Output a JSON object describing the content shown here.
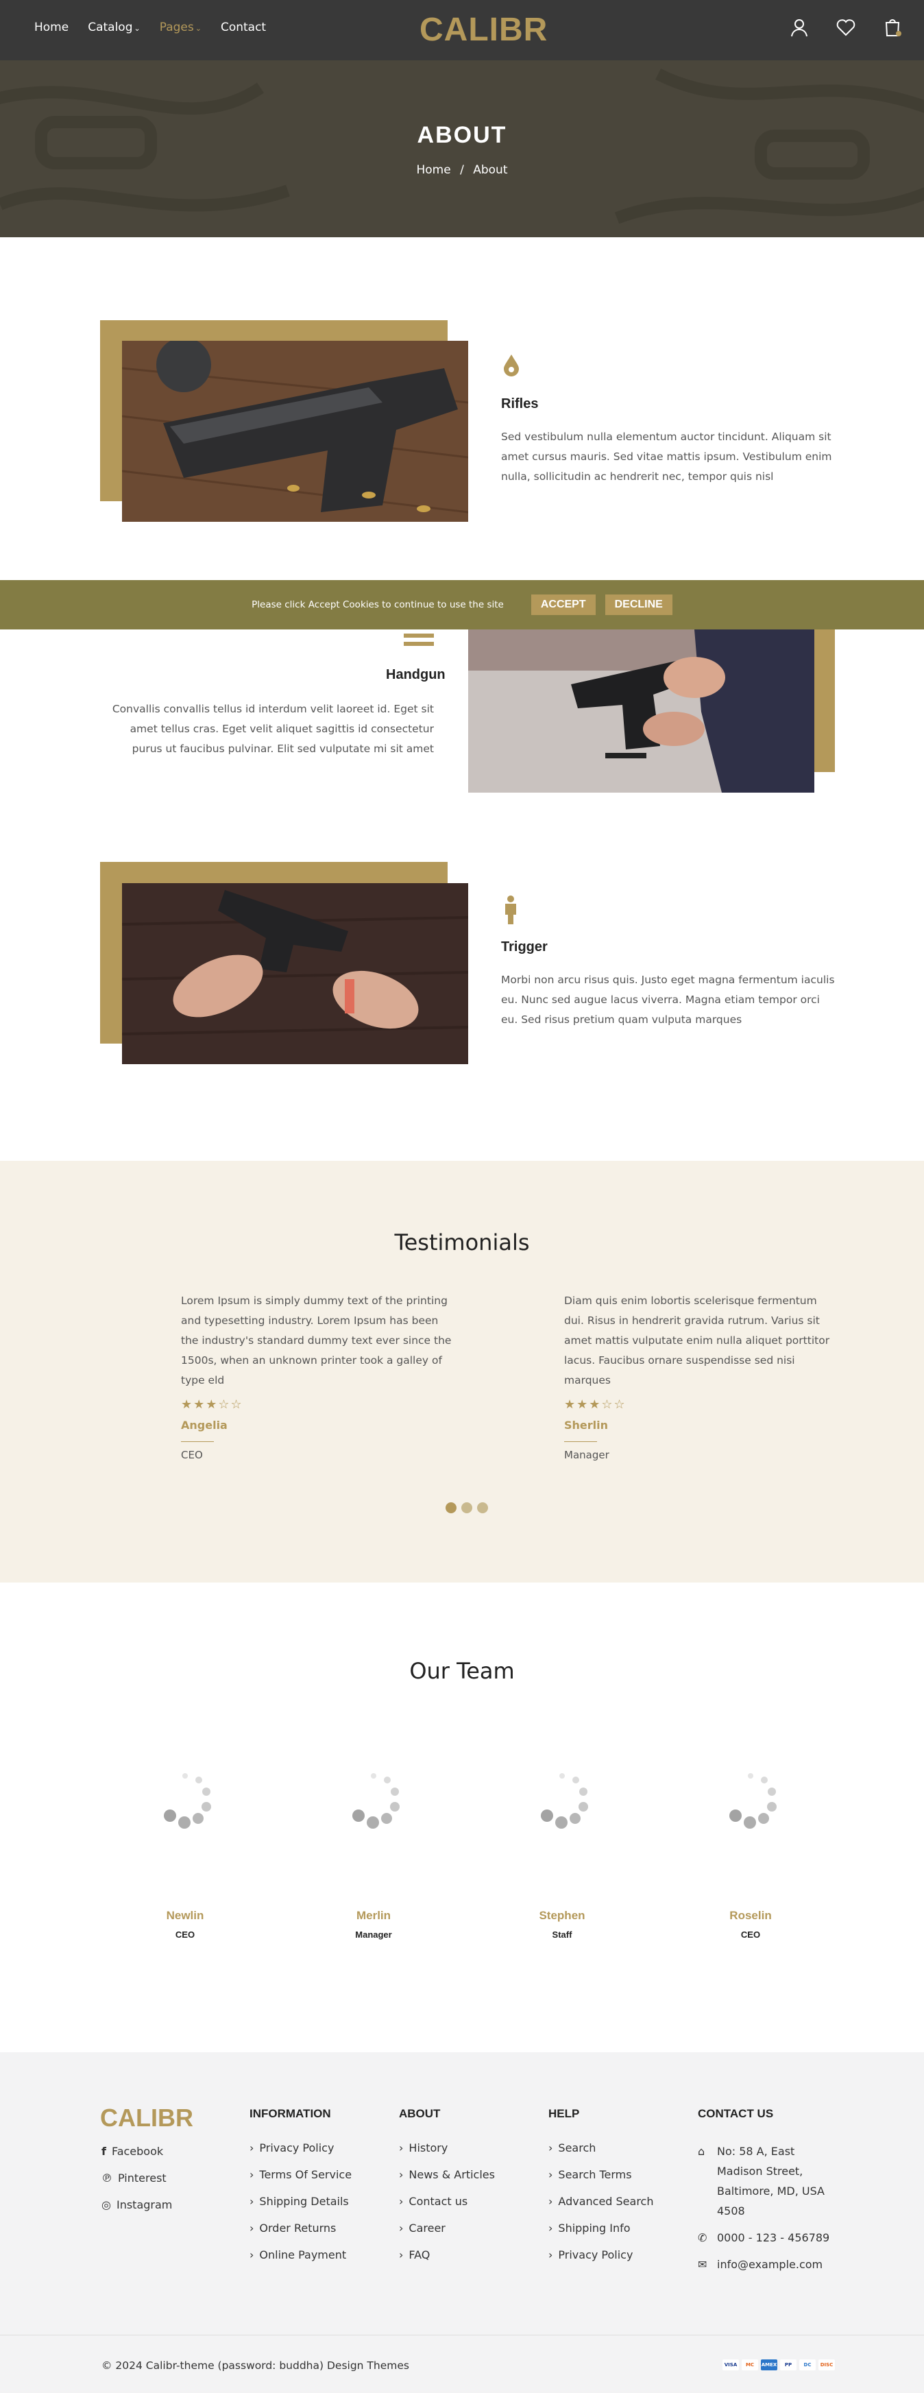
{
  "header": {
    "nav": [
      {
        "label": "Home"
      },
      {
        "label": "Catalog"
      },
      {
        "label": "Pages"
      },
      {
        "label": "Contact"
      }
    ],
    "logo": "CALIBR"
  },
  "hero": {
    "title": "ABOUT",
    "breadcrumb": {
      "home": "Home",
      "separator": "/",
      "current": "About"
    }
  },
  "features": [
    {
      "name": "Rifles",
      "icon": "drop-icon",
      "text": "Sed vestibulum nulla elementum auctor tincidunt. Aliquam sit amet cursus mauris. Sed vitae mattis ipsum. Vestibulum enim nulla, sollicitudin ac hendrerit nec, tempor quis nisl"
    },
    {
      "name": "Handgun",
      "icon": "rack-icon",
      "text": "Convallis convallis tellus id interdum velit laoreet id. Eget sit amet tellus cras. Eget velit aliquet sagittis id consectetur purus ut faucibus pulvinar. Elit sed vulputate mi sit amet"
    },
    {
      "name": "Trigger",
      "icon": "person-icon",
      "text": "Morbi non arcu risus quis. Justo eget magna fermentum iaculis eu. Nunc sed augue lacus viverra. Magna etiam tempor orci eu. Sed risus pretium quam vulputa marques"
    }
  ],
  "cookie": {
    "message": "Please click Accept Cookies to continue to use the site",
    "accept": "ACCEPT",
    "decline": "DECLINE"
  },
  "testimonials": {
    "title": "Testimonials",
    "items": [
      {
        "quote": "Lorem Ipsum is simply dummy text of the printing and typesetting industry. Lorem Ipsum has been the industry's standard dummy text ever since the 1500s, when an unknown printer took a galley of type eld",
        "stars": "★★★☆☆",
        "rating": 3,
        "name": "Angelia",
        "role": "CEO"
      },
      {
        "quote": "Diam quis enim lobortis scelerisque fermentum dui. Risus in hendrerit gravida rutrum. Varius sit amet mattis vulputate enim nulla aliquet porttitor lacus. Faucibus ornare suspendisse sed nisi marques",
        "stars": "★★★☆☆",
        "rating": 3,
        "name": "Sherlin",
        "role": "Manager"
      }
    ]
  },
  "team": {
    "title": "Our Team",
    "members": [
      {
        "name": "Newlin",
        "role": "CEO"
      },
      {
        "name": "Merlin",
        "role": "Manager"
      },
      {
        "name": "Stephen",
        "role": "Staff"
      },
      {
        "name": "Roselin",
        "role": "CEO"
      }
    ]
  },
  "footer": {
    "logo": "CALIBR",
    "social": [
      {
        "label": "Facebook",
        "icon": "facebook-icon"
      },
      {
        "label": "Pinterest",
        "icon": "pinterest-icon"
      },
      {
        "label": "Instagram",
        "icon": "instagram-icon"
      }
    ],
    "columns": [
      {
        "title": "INFORMATION",
        "links": [
          "Privacy Policy",
          "Terms Of Service",
          "Shipping Details",
          "Order Returns",
          "Online Payment"
        ]
      },
      {
        "title": "ABOUT",
        "links": [
          "History",
          "News & Articles",
          "Contact us",
          "Career",
          "FAQ"
        ]
      },
      {
        "title": "HELP",
        "links": [
          "Search",
          "Search Terms",
          "Advanced Search",
          "Shipping Info",
          "Privacy Policy"
        ]
      }
    ],
    "contact": {
      "title": "CONTACT US",
      "address": "No: 58 A, East Madison Street, Baltimore, MD, USA 4508",
      "phone": "0000 - 123 - 456789",
      "email": "info@example.com"
    },
    "copyright": "© 2024 Calibr-theme (password: buddha) Design Themes",
    "payments": [
      "VISA",
      "MC",
      "AMEX",
      "PP",
      "DC",
      "DISC"
    ]
  },
  "colors": {
    "accent": "#b4995a",
    "header": "#393939",
    "cookie_bar": "#837c44",
    "testimonial_bg": "#f6f1e7"
  }
}
